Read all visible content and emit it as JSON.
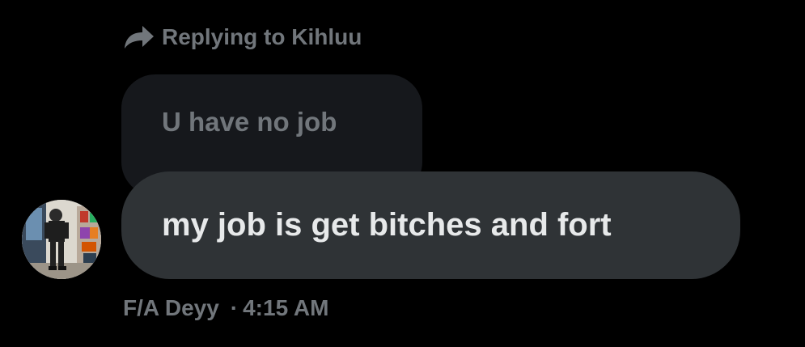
{
  "reply_context": {
    "icon": "reply-arrow-icon",
    "text": "Replying to Kihluu"
  },
  "quoted_message": {
    "text": "U have no job"
  },
  "message": {
    "text": "my job is get bitches and fort"
  },
  "meta": {
    "sender": "F/A Deyy",
    "separator": "·",
    "time": "4:15 AM"
  },
  "colors": {
    "background": "#000000",
    "muted_text": "#71767b",
    "quoted_bubble": "#16181c",
    "message_bubble": "#2f3336",
    "message_text": "#e7e9ea"
  }
}
